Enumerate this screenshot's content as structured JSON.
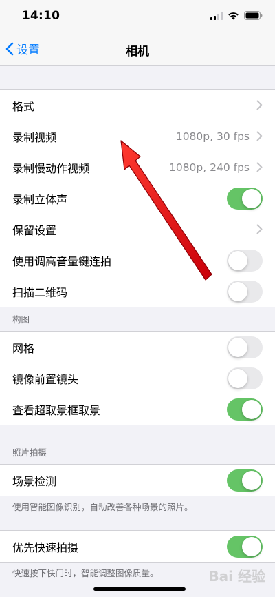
{
  "status": {
    "time": "14:10"
  },
  "nav": {
    "back_label": "设置",
    "title": "相机"
  },
  "group1": [
    {
      "label": "格式",
      "value": "",
      "control": "chevron"
    },
    {
      "label": "录制视频",
      "value": "1080p, 30 fps",
      "control": "chevron"
    },
    {
      "label": "录制慢动作视频",
      "value": "1080p, 240 fps",
      "control": "chevron"
    },
    {
      "label": "录制立体声",
      "control": "toggle",
      "on": true
    },
    {
      "label": "保留设置",
      "value": "",
      "control": "chevron"
    },
    {
      "label": "使用调高音量键连拍",
      "control": "toggle",
      "on": false
    },
    {
      "label": "扫描二维码",
      "control": "toggle",
      "on": false
    }
  ],
  "composition": {
    "header": "构图",
    "items": [
      {
        "label": "网格",
        "on": false
      },
      {
        "label": "镜像前置镜头",
        "on": false
      },
      {
        "label": "查看超取景框取景",
        "on": true
      }
    ]
  },
  "photo_capture": {
    "header": "照片拍摄",
    "scene_detection": {
      "label": "场景检测",
      "on": true
    },
    "scene_detection_footer": "使用智能图像识别，自动改善各种场景的照片。",
    "prioritize_faster": {
      "label": "优先快速拍摄",
      "on": true
    },
    "prioritize_footer": "快速按下快门时，智能调整图像质量。"
  },
  "colors": {
    "accent": "#007aff",
    "toggle_on": "#65c466",
    "toggle_off": "#e9e9eb",
    "annotation_arrow": "#e8141b"
  },
  "watermark": "Bai 经验"
}
